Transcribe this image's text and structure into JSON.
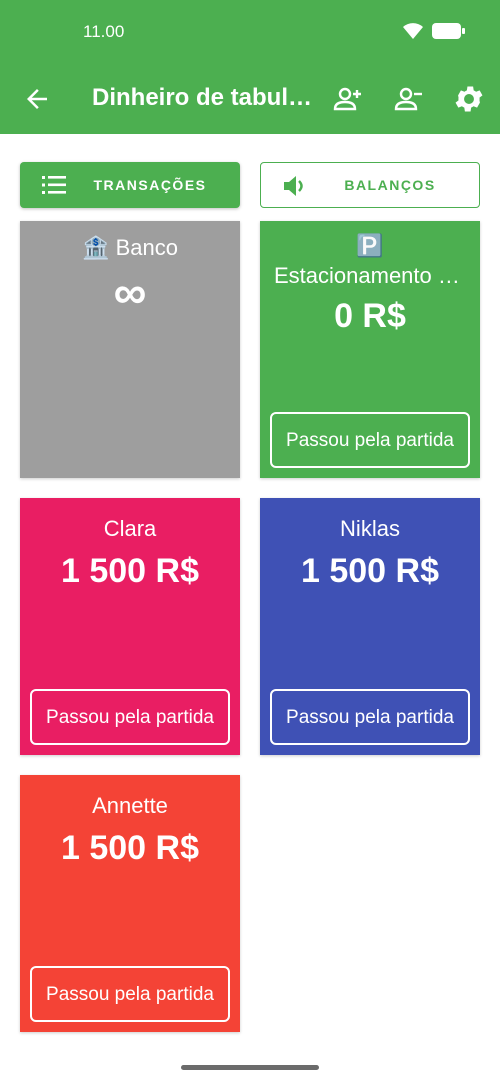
{
  "status": {
    "time": "11.00"
  },
  "header": {
    "title": "Dinheiro de tabuleiro",
    "add_player_icon": "person-add-icon",
    "remove_player_icon": "person-remove-icon",
    "settings_icon": "gear-icon"
  },
  "tabs": {
    "transactions": "TRANSAÇÕES",
    "balances": "BALANÇOS"
  },
  "bank": {
    "emoji": "🏦",
    "label": "Banco",
    "amount": "∞"
  },
  "parking": {
    "emoji": "🅿️",
    "label": "Estacionamento gratuito",
    "amount": "0 R$",
    "button": "Passou pela partida"
  },
  "players": [
    {
      "name": "Clara",
      "amount": "1 500 R$",
      "button": "Passou pela partida",
      "color": "#e91e63"
    },
    {
      "name": "Niklas",
      "amount": "1 500 R$",
      "button": "Passou pela partida",
      "color": "#3f51b5"
    },
    {
      "name": "Annette",
      "amount": "1 500 R$",
      "button": "Passou pela partida",
      "color": "#f44336"
    }
  ],
  "colors": {
    "primary": "#4caf50",
    "bank": "#9e9e9e"
  }
}
